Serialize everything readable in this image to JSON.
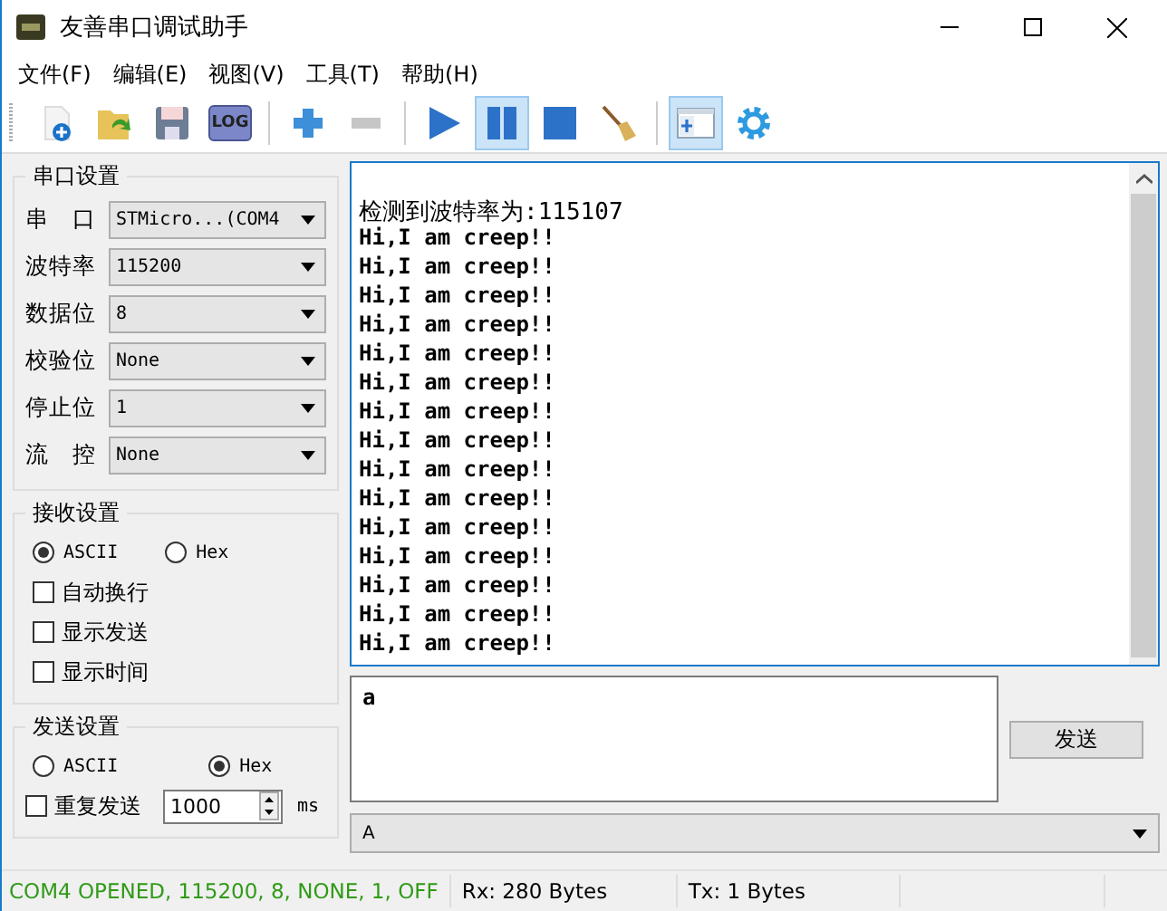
{
  "window": {
    "title": "友善串口调试助手"
  },
  "menu": [
    "文件(F)",
    "编辑(E)",
    "视图(V)",
    "工具(T)",
    "帮助(H)"
  ],
  "toolbar": [
    {
      "kind": "new",
      "selected": false,
      "disabled": false
    },
    {
      "kind": "open",
      "selected": false,
      "disabled": false
    },
    {
      "kind": "save",
      "selected": false,
      "disabled": false
    },
    {
      "kind": "log",
      "label": "LOG",
      "selected": false,
      "disabled": false
    },
    {
      "kind": "sep"
    },
    {
      "kind": "add",
      "selected": false,
      "disabled": false
    },
    {
      "kind": "remove",
      "selected": false,
      "disabled": true
    },
    {
      "kind": "sep"
    },
    {
      "kind": "play",
      "selected": false,
      "disabled": false
    },
    {
      "kind": "pause",
      "selected": true,
      "disabled": false
    },
    {
      "kind": "stop",
      "selected": false,
      "disabled": false
    },
    {
      "kind": "broom",
      "selected": false,
      "disabled": false
    },
    {
      "kind": "sep"
    },
    {
      "kind": "layout",
      "selected": true,
      "disabled": false
    },
    {
      "kind": "gear",
      "selected": false,
      "disabled": false
    }
  ],
  "port_settings": {
    "title": "串口设置",
    "fields": [
      {
        "label": "串　口",
        "value": "STMicro...(COM4"
      },
      {
        "label": "波特率",
        "value": "115200"
      },
      {
        "label": "数据位",
        "value": "8"
      },
      {
        "label": "校验位",
        "value": "None"
      },
      {
        "label": "停止位",
        "value": "1"
      },
      {
        "label": "流　控",
        "value": "None"
      }
    ]
  },
  "receive_settings": {
    "title": "接收设置",
    "modes": [
      {
        "label": "ASCII",
        "selected": true
      },
      {
        "label": "Hex",
        "selected": false
      }
    ],
    "options": [
      {
        "label": "自动换行",
        "checked": false
      },
      {
        "label": "显示发送",
        "checked": false
      },
      {
        "label": "显示时间",
        "checked": false
      }
    ]
  },
  "send_settings": {
    "title": "发送设置",
    "modes": [
      {
        "label": "ASCII",
        "selected": false
      },
      {
        "label": "Hex",
        "selected": true
      }
    ],
    "repeat": {
      "label": "重复发送",
      "checked": false,
      "value": "1000",
      "unit": "ms"
    }
  },
  "receive_area": {
    "lines": [
      "检测到波特率为:115107",
      "Hi,I am creep!!",
      "Hi,I am creep!!",
      "Hi,I am creep!!",
      "Hi,I am creep!!",
      "Hi,I am creep!!",
      "Hi,I am creep!!",
      "Hi,I am creep!!",
      "Hi,I am creep!!",
      "Hi,I am creep!!",
      "Hi,I am creep!!",
      "Hi,I am creep!!",
      "Hi,I am creep!!",
      "Hi,I am creep!!",
      "Hi,I am creep!!",
      "Hi,I am creep!!"
    ]
  },
  "send_area": {
    "value": "a",
    "button": "发送",
    "history": "A"
  },
  "status_bar": {
    "connection": "COM4 OPENED, 115200, 8, NONE, 1, OFF",
    "rx": "Rx: 280 Bytes",
    "tx": "Tx: 1 Bytes"
  }
}
